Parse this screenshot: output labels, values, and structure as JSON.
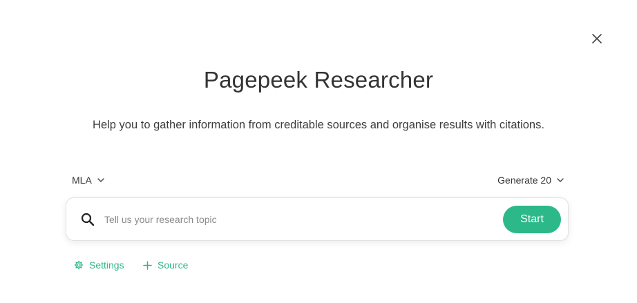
{
  "dialog": {
    "title": "Pagepeek Researcher",
    "subtitle": "Help you to gather information from creditable sources and organise results with citations.",
    "close_icon": "close-icon"
  },
  "controls": {
    "citation_style": "MLA",
    "generate_count": "Generate 20",
    "chevron_icon": "chevron-down-icon"
  },
  "search": {
    "placeholder": "Tell us your research topic",
    "value": "",
    "icon": "search-icon",
    "start_label": "Start"
  },
  "links": {
    "settings_label": "Settings",
    "settings_icon": "gear-icon",
    "source_label": "Source",
    "source_icon": "plus-icon"
  },
  "colors": {
    "accent": "#2db88a",
    "text": "#333333",
    "placeholder": "#8a8a8a"
  }
}
